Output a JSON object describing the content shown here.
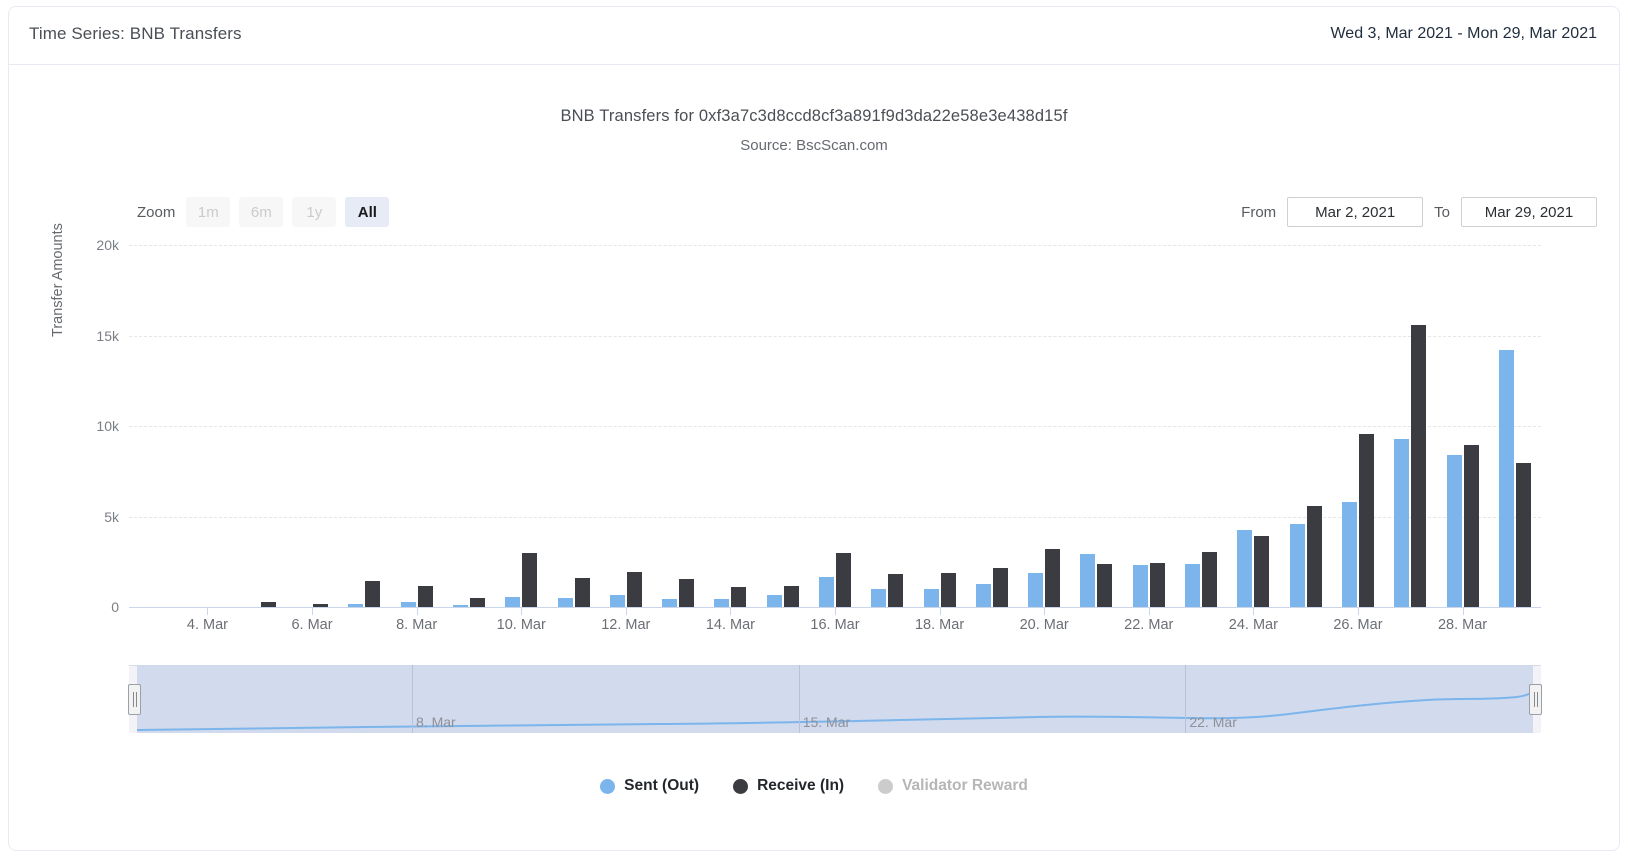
{
  "header": {
    "title": "Time Series: BNB Transfers",
    "date_range": "Wed 3, Mar 2021 - Mon 29, Mar 2021"
  },
  "chart_header": {
    "title": "BNB Transfers for 0xf3a7c3d8ccd8cf3a891f9d3da22e58e3e438d15f",
    "subtitle": "Source: BscScan.com"
  },
  "range_selector": {
    "zoom_label": "Zoom",
    "buttons": [
      {
        "label": "1m",
        "active": false
      },
      {
        "label": "6m",
        "active": false
      },
      {
        "label": "1y",
        "active": false
      },
      {
        "label": "All",
        "active": true
      }
    ],
    "from_label": "From",
    "from_value": "Mar 2, 2021",
    "to_label": "To",
    "to_value": "Mar 29, 2021"
  },
  "navigator": {
    "labels": [
      "8. Mar",
      "15. Mar",
      "22. Mar"
    ]
  },
  "legend": [
    {
      "label": "Sent (Out)",
      "color": "#7cb5ec",
      "disabled": false
    },
    {
      "label": "Receive (In)",
      "color": "#3a3c41",
      "disabled": false
    },
    {
      "label": "Validator Reward",
      "color": "#cccccc",
      "disabled": true
    }
  ],
  "chart_data": {
    "type": "bar",
    "title": "BNB Transfers for 0xf3a7c3d8ccd8cf3a891f9d3da22e58e3e438d15f",
    "subtitle": "Source: BscScan.com",
    "xlabel": "",
    "ylabel": "Transfer Amounts",
    "ylim": [
      0,
      20000
    ],
    "yticks": [
      0,
      5000,
      10000,
      15000,
      20000
    ],
    "ytick_labels": [
      "0",
      "5k",
      "10k",
      "15k",
      "20k"
    ],
    "grid": true,
    "legend_position": "bottom",
    "categories": [
      "3. Mar",
      "4. Mar",
      "5. Mar",
      "6. Mar",
      "7. Mar",
      "8. Mar",
      "9. Mar",
      "10. Mar",
      "11. Mar",
      "12. Mar",
      "13. Mar",
      "14. Mar",
      "15. Mar",
      "16. Mar",
      "17. Mar",
      "18. Mar",
      "19. Mar",
      "20. Mar",
      "21. Mar",
      "22. Mar",
      "23. Mar",
      "24. Mar",
      "25. Mar",
      "26. Mar",
      "27. Mar",
      "28. Mar",
      "29. Mar"
    ],
    "xtick_labels": [
      "4. Mar",
      "6. Mar",
      "8. Mar",
      "10. Mar",
      "12. Mar",
      "14. Mar",
      "16. Mar",
      "18. Mar",
      "20. Mar",
      "22. Mar",
      "24. Mar",
      "26. Mar",
      "28. Mar"
    ],
    "series": [
      {
        "name": "Sent (Out)",
        "color": "#7cb5ec",
        "values": [
          0,
          0,
          0,
          0,
          180,
          300,
          120,
          580,
          520,
          680,
          460,
          470,
          650,
          1650,
          1000,
          1000,
          1250,
          1900,
          2950,
          2300,
          2350,
          4250,
          4600,
          5800,
          9300,
          8400,
          14200
        ]
      },
      {
        "name": "Receive (In)",
        "color": "#3a3c41",
        "values": [
          0,
          0,
          280,
          180,
          1450,
          1150,
          480,
          3000,
          1600,
          1950,
          1550,
          1080,
          1150,
          3000,
          1800,
          1880,
          2150,
          3200,
          2400,
          2450,
          3050,
          3950,
          5600,
          9550,
          15600,
          8950,
          7950
        ]
      },
      {
        "name": "Validator Reward",
        "color": "#cccccc",
        "values": [
          0,
          0,
          0,
          0,
          0,
          0,
          0,
          0,
          0,
          0,
          0,
          0,
          0,
          0,
          0,
          0,
          0,
          0,
          0,
          0,
          0,
          0,
          0,
          0,
          0,
          0,
          0
        ]
      }
    ]
  }
}
